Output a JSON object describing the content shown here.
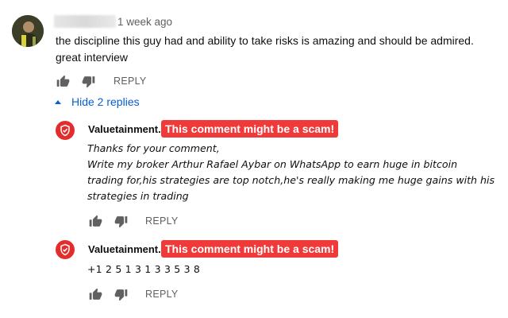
{
  "comment": {
    "author_name_blurred": true,
    "timestamp": "1 week ago",
    "text_line1": "the discipline this guy had and ability to take risks is amazing and should be admired.",
    "text_line2": "great interview",
    "reply_label": "REPLY",
    "like_icon": "thumbs-up-icon",
    "dislike_icon": "thumbs-down-icon"
  },
  "replies_toggle": {
    "label": "Hide 2 replies",
    "icon": "caret-up-icon",
    "color": "#065fd4"
  },
  "replies": [
    {
      "author": "Valuetainment.",
      "badge": "This comment might be a scam!",
      "lines": [
        "Thanks for your comment,",
        "Write my broker Arthur Rafael Aybar on WhatsApp to earn huge in bitcoin",
        "trading for,his strategies are top notch,he's really making me huge gains with his",
        "strategies in trading"
      ],
      "reply_label": "REPLY"
    },
    {
      "author": "Valuetainment.",
      "badge": "This comment might be a scam!",
      "text": "+1 2 5 1 3 1 3 3 5 3 8",
      "reply_label": "REPLY"
    }
  ],
  "colors": {
    "badge_bg": "#f03a3a",
    "avatar_red": "#e32c2c",
    "meta_gray": "#606060"
  }
}
